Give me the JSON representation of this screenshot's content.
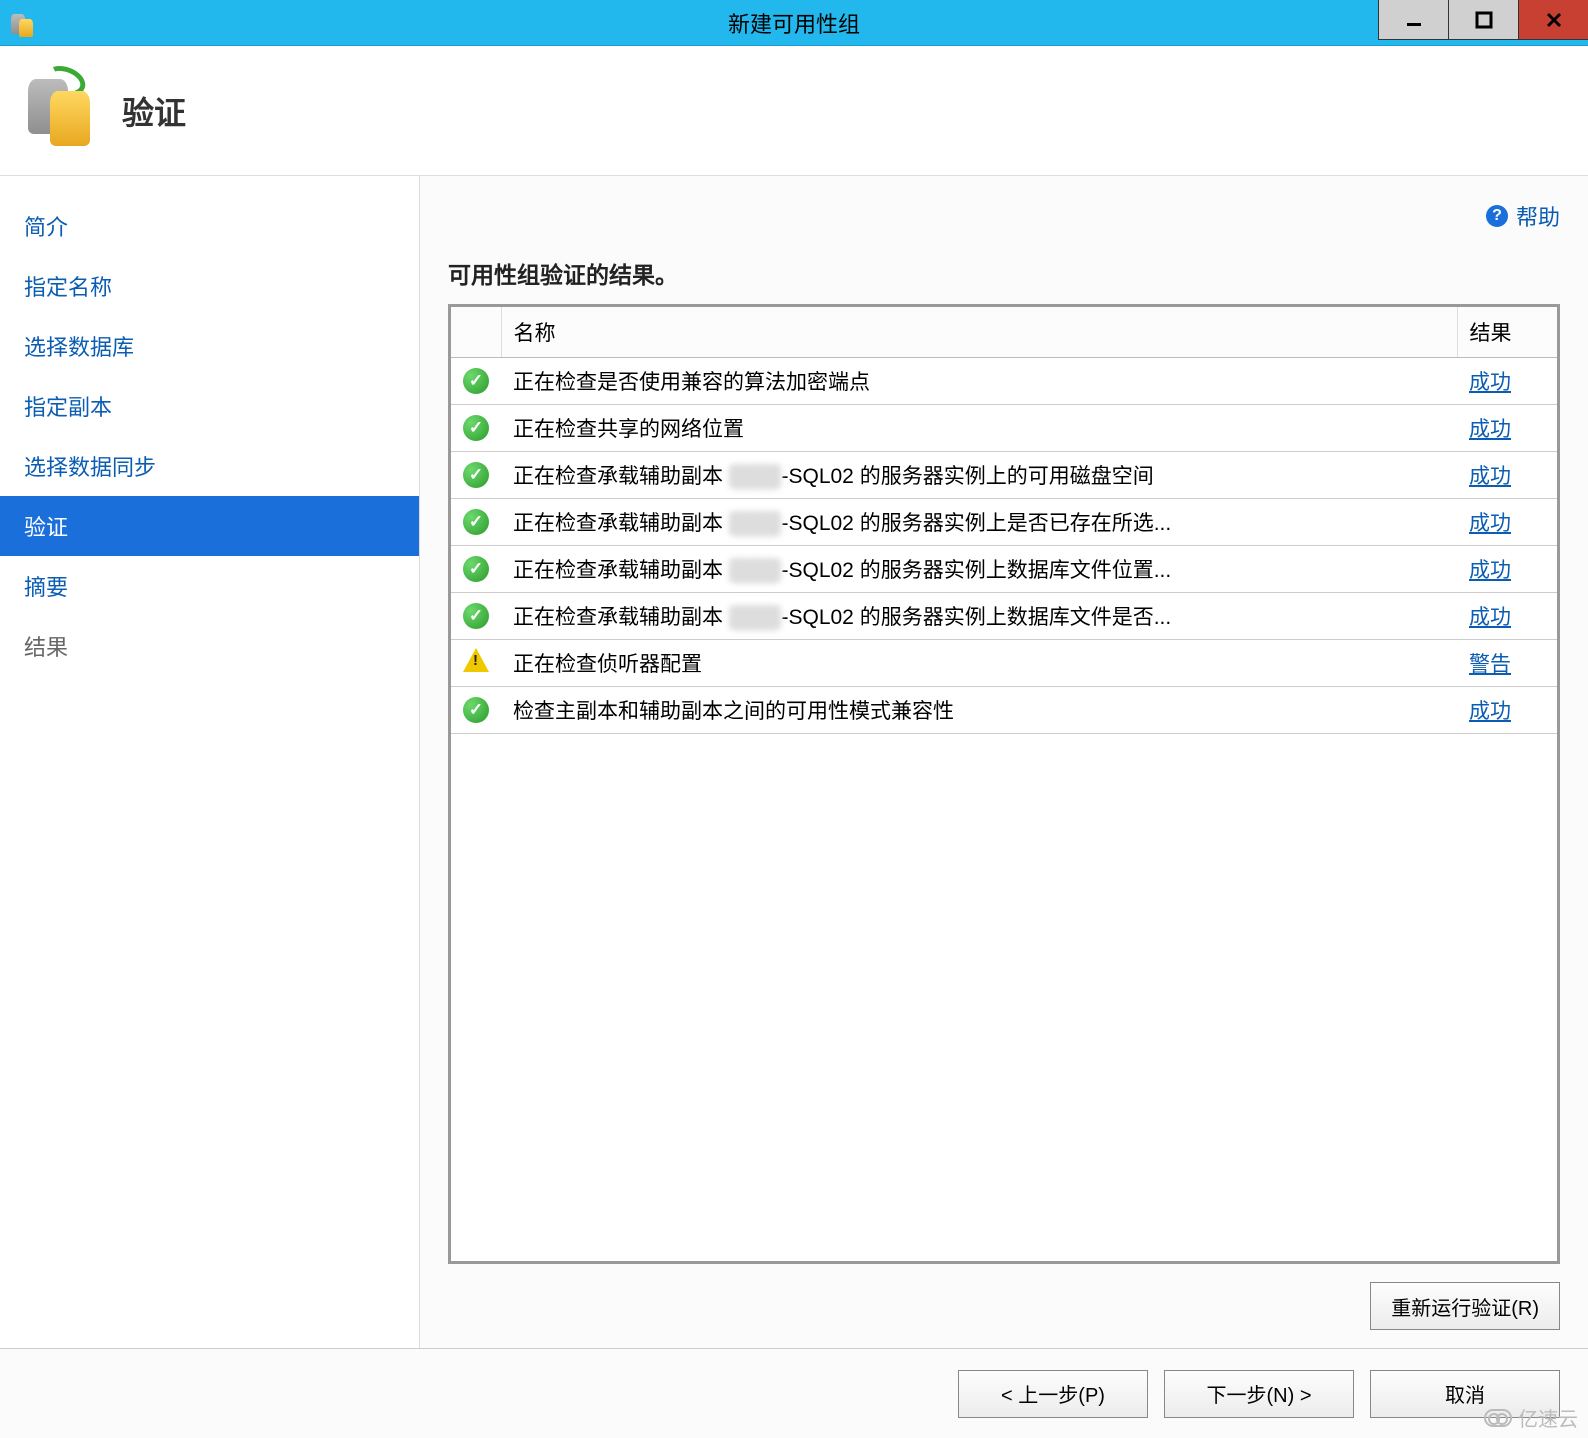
{
  "window": {
    "title": "新建可用性组",
    "minimize": "—",
    "maximize": "□",
    "close": "✕"
  },
  "header": {
    "title": "验证"
  },
  "help": {
    "label": "帮助"
  },
  "sidebar": {
    "items": [
      {
        "label": "简介",
        "state": "link"
      },
      {
        "label": "指定名称",
        "state": "link"
      },
      {
        "label": "选择数据库",
        "state": "link"
      },
      {
        "label": "指定副本",
        "state": "link"
      },
      {
        "label": "选择数据同步",
        "state": "link"
      },
      {
        "label": "验证",
        "state": "selected"
      },
      {
        "label": "摘要",
        "state": "link"
      },
      {
        "label": "结果",
        "state": "disabled"
      }
    ]
  },
  "main": {
    "heading": "可用性组验证的结果。",
    "columns": {
      "icon": "",
      "name": "名称",
      "result": "结果"
    },
    "rows": [
      {
        "status": "success",
        "name_pre": "正在检查是否使用兼容的算法加密端点",
        "name_mid": "",
        "name_post": "",
        "result": "成功"
      },
      {
        "status": "success",
        "name_pre": "正在检查共享的网络位置",
        "name_mid": "",
        "name_post": "",
        "result": "成功"
      },
      {
        "status": "success",
        "name_pre": "正在检查承载辅助副本 ",
        "name_mid": "███",
        "name_post": "-SQL02 的服务器实例上的可用磁盘空间",
        "result": "成功"
      },
      {
        "status": "success",
        "name_pre": "正在检查承载辅助副本 ",
        "name_mid": "███",
        "name_post": "-SQL02 的服务器实例上是否已存在所选...",
        "result": "成功"
      },
      {
        "status": "success",
        "name_pre": "正在检查承载辅助副本 ",
        "name_mid": "███",
        "name_post": "-SQL02 的服务器实例上数据库文件位置...",
        "result": "成功"
      },
      {
        "status": "success",
        "name_pre": "正在检查承载辅助副本 ",
        "name_mid": "███",
        "name_post": "-SQL02 的服务器实例上数据库文件是否...",
        "result": "成功"
      },
      {
        "status": "warning",
        "name_pre": "正在检查侦听器配置",
        "name_mid": "",
        "name_post": "",
        "result": "警告"
      },
      {
        "status": "success",
        "name_pre": "检查主副本和辅助副本之间的可用性模式兼容性",
        "name_mid": "",
        "name_post": "",
        "result": "成功"
      }
    ],
    "rerun": "重新运行验证(R)"
  },
  "footer": {
    "prev": "< 上一步(P)",
    "next": "下一步(N) >",
    "cancel": "取消"
  },
  "watermark": "亿速云"
}
